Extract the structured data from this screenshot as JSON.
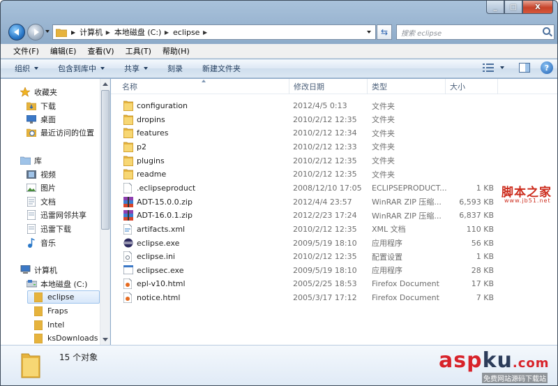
{
  "window": {
    "close_glyph": "X"
  },
  "nav": {
    "breadcrumb": [
      "计算机",
      "本地磁盘 (C:)",
      "eclipse"
    ],
    "search_placeholder": "搜索 eclipse"
  },
  "menu": [
    "文件(F)",
    "编辑(E)",
    "查看(V)",
    "工具(T)",
    "帮助(H)"
  ],
  "toolbar": {
    "organize": "组织",
    "include_library": "包含到库中",
    "share": "共享",
    "burn": "刻录",
    "new_folder": "新建文件夹"
  },
  "sidebar": {
    "items": [
      {
        "label": "收藏夹",
        "icon": "star-icon"
      },
      {
        "label": "下载",
        "icon": "download-folder-icon"
      },
      {
        "label": "桌面",
        "icon": "desktop-icon"
      },
      {
        "label": "最近访问的位置",
        "icon": "recent-places-icon"
      },
      {
        "label": "库",
        "icon": "library-icon"
      },
      {
        "label": "视频",
        "icon": "video-library-icon"
      },
      {
        "label": "图片",
        "icon": "picture-library-icon"
      },
      {
        "label": "文档",
        "icon": "document-library-icon"
      },
      {
        "label": "迅雷网邻共享",
        "icon": "share-library-icon"
      },
      {
        "label": "迅雷下载",
        "icon": "download-library-icon"
      },
      {
        "label": "音乐",
        "icon": "music-icon"
      },
      {
        "label": "计算机",
        "icon": "computer-icon"
      },
      {
        "label": "本地磁盘 (C:)",
        "icon": "drive-icon"
      },
      {
        "label": "eclipse",
        "icon": "folder-icon"
      },
      {
        "label": "Fraps",
        "icon": "folder-icon"
      },
      {
        "label": "Intel",
        "icon": "folder-icon"
      },
      {
        "label": "ksDownloads",
        "icon": "folder-icon"
      }
    ]
  },
  "columns": {
    "name": "名称",
    "date": "修改日期",
    "type": "类型",
    "size": "大小"
  },
  "files": [
    {
      "name": "configuration",
      "date": "2012/4/5 0:13",
      "type": "文件夹",
      "size": "",
      "icon": "folder-icon"
    },
    {
      "name": "dropins",
      "date": "2010/2/12 12:35",
      "type": "文件夹",
      "size": "",
      "icon": "folder-icon"
    },
    {
      "name": "features",
      "date": "2010/2/12 12:34",
      "type": "文件夹",
      "size": "",
      "icon": "folder-icon"
    },
    {
      "name": "p2",
      "date": "2010/2/12 12:33",
      "type": "文件夹",
      "size": "",
      "icon": "folder-icon"
    },
    {
      "name": "plugins",
      "date": "2010/2/12 12:35",
      "type": "文件夹",
      "size": "",
      "icon": "folder-icon"
    },
    {
      "name": "readme",
      "date": "2010/2/12 12:35",
      "type": "文件夹",
      "size": "",
      "icon": "folder-icon"
    },
    {
      "name": ".eclipseproduct",
      "date": "2008/12/10 17:05",
      "type": "ECLIPSEPRODUCT...",
      "size": "1 KB",
      "icon": "file-icon"
    },
    {
      "name": "ADT-15.0.0.zip",
      "date": "2012/4/4 23:57",
      "type": "WinRAR ZIP 压缩...",
      "size": "6,593 KB",
      "icon": "winrar-icon"
    },
    {
      "name": "ADT-16.0.1.zip",
      "date": "2012/2/23 17:24",
      "type": "WinRAR ZIP 压缩...",
      "size": "6,837 KB",
      "icon": "winrar-icon"
    },
    {
      "name": "artifacts.xml",
      "date": "2010/2/12 12:35",
      "type": "XML 文档",
      "size": "110 KB",
      "icon": "xml-icon"
    },
    {
      "name": "eclipse.exe",
      "date": "2009/5/19 18:10",
      "type": "应用程序",
      "size": "56 KB",
      "icon": "eclipse-icon"
    },
    {
      "name": "eclipse.ini",
      "date": "2010/2/12 12:35",
      "type": "配置设置",
      "size": "1 KB",
      "icon": "ini-icon"
    },
    {
      "name": "eclipsec.exe",
      "date": "2009/5/19 18:10",
      "type": "应用程序",
      "size": "28 KB",
      "icon": "exe-icon"
    },
    {
      "name": "epl-v10.html",
      "date": "2005/2/25 18:53",
      "type": "Firefox Document",
      "size": "17 KB",
      "icon": "html-icon"
    },
    {
      "name": "notice.html",
      "date": "2005/3/17 17:12",
      "type": "Firefox Document",
      "size": "7 KB",
      "icon": "html-icon"
    }
  ],
  "status": {
    "count": "15 个对象"
  },
  "watermarks": {
    "site_cn": "脚本之家",
    "site_url": "www.jb51.net",
    "aspku_a": "asp",
    "aspku_b": "ku",
    "aspku_c": ".com",
    "aspku_sub": "免费网站源码下载站"
  },
  "colors": {
    "accent": "#2a78c8",
    "folder": "#e6b33d",
    "selection": "#d7e7fa",
    "watermark": "#cc2b1c"
  }
}
